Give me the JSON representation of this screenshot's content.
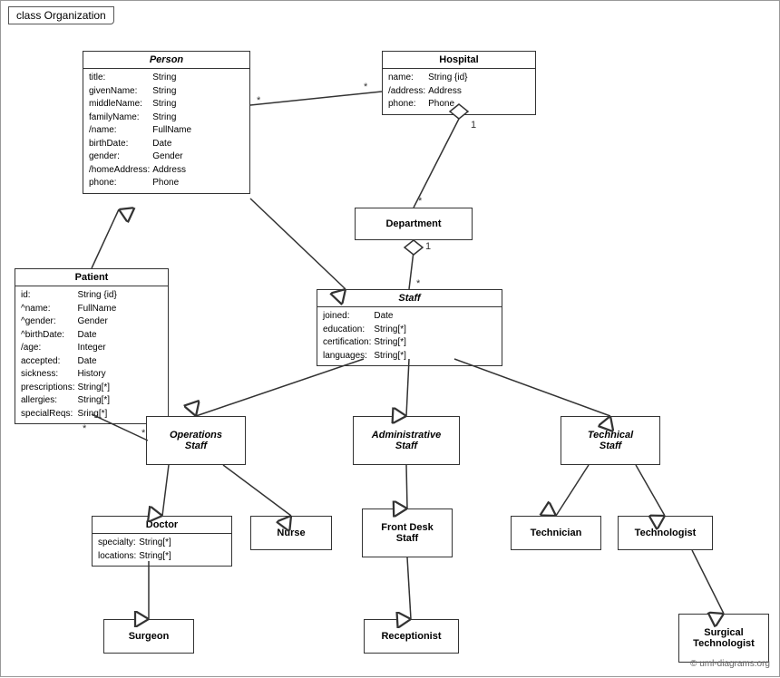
{
  "title": "class Organization",
  "classes": {
    "person": {
      "name": "Person",
      "italic": true,
      "attrs": [
        [
          "title:",
          "String"
        ],
        [
          "givenName:",
          "String"
        ],
        [
          "middleName:",
          "String"
        ],
        [
          "familyName:",
          "String"
        ],
        [
          "/name:",
          "FullName"
        ],
        [
          "birthDate:",
          "Date"
        ],
        [
          "gender:",
          "Gender"
        ],
        [
          "/homeAddress:",
          "Address"
        ],
        [
          "phone:",
          "Phone"
        ]
      ]
    },
    "hospital": {
      "name": "Hospital",
      "attrs": [
        [
          "name:",
          "String {id}"
        ],
        [
          "/address:",
          "Address"
        ],
        [
          "phone:",
          "Phone"
        ]
      ]
    },
    "patient": {
      "name": "Patient",
      "attrs": [
        [
          "id:",
          "String {id}"
        ],
        [
          "^name:",
          "FullName"
        ],
        [
          "^gender:",
          "Gender"
        ],
        [
          "^birthDate:",
          "Date"
        ],
        [
          "/age:",
          "Integer"
        ],
        [
          "accepted:",
          "Date"
        ],
        [
          "sickness:",
          "History"
        ],
        [
          "prescriptions:",
          "String[*]"
        ],
        [
          "allergies:",
          "String[*]"
        ],
        [
          "specialReqs:",
          "Sring[*]"
        ]
      ]
    },
    "department": {
      "name": "Department"
    },
    "staff": {
      "name": "Staff",
      "italic": true,
      "attrs": [
        [
          "joined:",
          "Date"
        ],
        [
          "education:",
          "String[*]"
        ],
        [
          "certification:",
          "String[*]"
        ],
        [
          "languages:",
          "String[*]"
        ]
      ]
    },
    "operations_staff": {
      "name": "Operations\nStaff",
      "italic": true
    },
    "administrative_staff": {
      "name": "Administrative\nStaff",
      "italic": true
    },
    "technical_staff": {
      "name": "Technical\nStaff",
      "italic": true
    },
    "doctor": {
      "name": "Doctor",
      "attrs": [
        [
          "specialty:",
          "String[*]"
        ],
        [
          "locations:",
          "String[*]"
        ]
      ]
    },
    "nurse": {
      "name": "Nurse"
    },
    "front_desk_staff": {
      "name": "Front Desk\nStaff"
    },
    "technician": {
      "name": "Technician"
    },
    "technologist": {
      "name": "Technologist"
    },
    "surgeon": {
      "name": "Surgeon"
    },
    "receptionist": {
      "name": "Receptionist"
    },
    "surgical_technologist": {
      "name": "Surgical\nTechnologist"
    }
  },
  "copyright": "© uml-diagrams.org"
}
